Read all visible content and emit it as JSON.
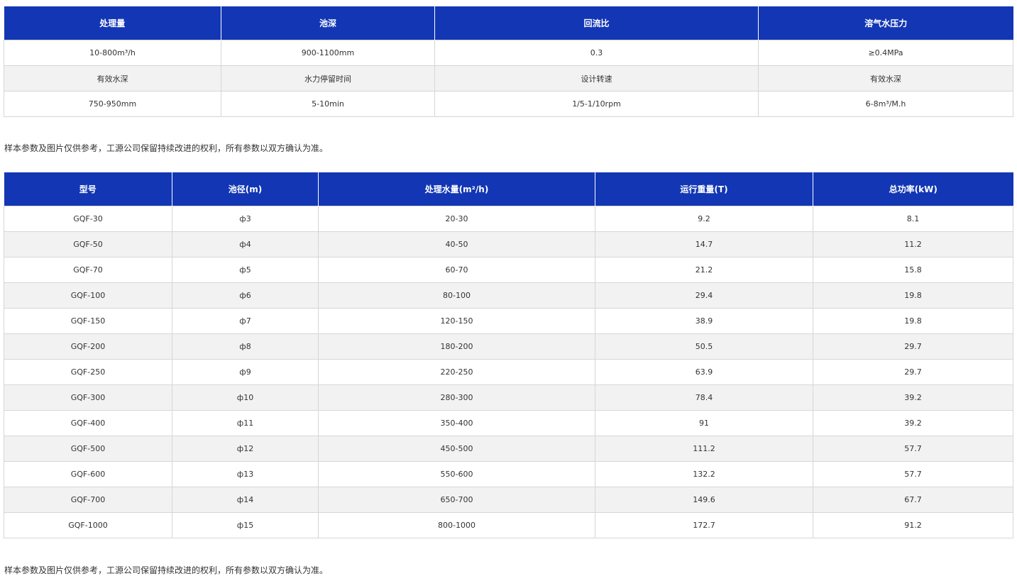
{
  "table1": {
    "headers": [
      "处理量",
      "池深",
      "回流比",
      "溶气水压力"
    ],
    "rows": [
      [
        "10-800m³/h",
        "900-1100mm",
        "0.3",
        "≥0.4MPa"
      ],
      [
        "有效水深",
        "水力停留时间",
        "设计转速",
        "有效水深"
      ],
      [
        "750-950mm",
        "5-10min",
        "1/5-1/10rpm",
        "6-8m³/M.h"
      ]
    ]
  },
  "note1": "样本参数及图片仅供参考，工源公司保留持续改进的权利，所有参数以双方确认为准。",
  "table2": {
    "headers": [
      "型号",
      "池径(m)",
      "处理水量(m²/h)",
      "运行重量(T)",
      "总功率(kW)"
    ],
    "rows": [
      [
        "GQF-30",
        "ф3",
        "20-30",
        "9.2",
        "8.1"
      ],
      [
        "GQF-50",
        "ф4",
        "40-50",
        "14.7",
        "11.2"
      ],
      [
        "GQF-70",
        "ф5",
        "60-70",
        "21.2",
        "15.8"
      ],
      [
        "GQF-100",
        "ф6",
        "80-100",
        "29.4",
        "19.8"
      ],
      [
        "GQF-150",
        "ф7",
        "120-150",
        "38.9",
        "19.8"
      ],
      [
        "GQF-200",
        "ф8",
        "180-200",
        "50.5",
        "29.7"
      ],
      [
        "GQF-250",
        "ф9",
        "220-250",
        "63.9",
        "29.7"
      ],
      [
        "GQF-300",
        "ф10",
        "280-300",
        "78.4",
        "39.2"
      ],
      [
        "GQF-400",
        "ф11",
        "350-400",
        "91",
        "39.2"
      ],
      [
        "GQF-500",
        "ф12",
        "450-500",
        "111.2",
        "57.7"
      ],
      [
        "GQF-600",
        "ф13",
        "550-600",
        "132.2",
        "57.7"
      ],
      [
        "GQF-700",
        "ф14",
        "650-700",
        "149.6",
        "67.7"
      ],
      [
        "GQF-1000",
        "ф15",
        "800-1000",
        "172.7",
        "91.2"
      ]
    ]
  },
  "note2": "样本参数及图片仅供参考，工源公司保留持续改进的权利，所有参数以双方确认为准。",
  "colors": {
    "header_bg": "#1236b4",
    "alt_row_bg": "#f2f2f2",
    "border": "#d6d6d6"
  }
}
